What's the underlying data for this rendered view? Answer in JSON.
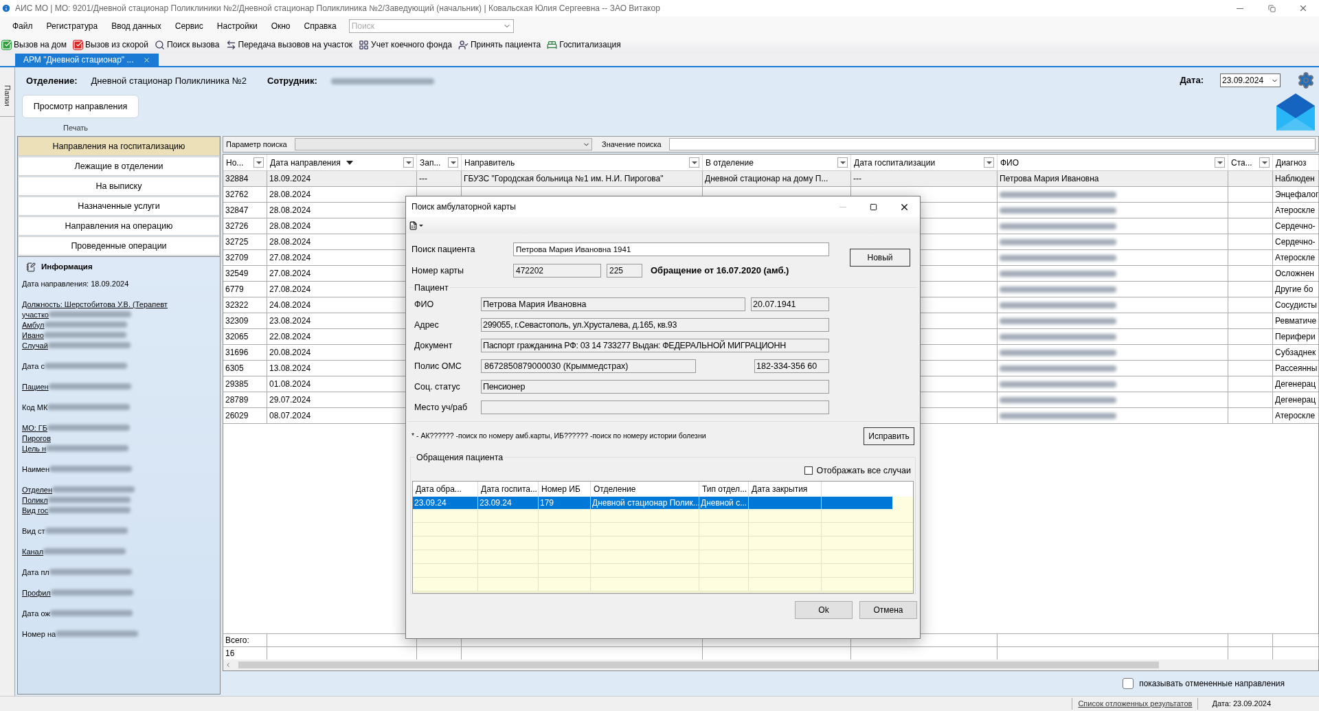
{
  "window": {
    "title": "АИС МО | МО: 9201/Дневной стационар Поликлиники №2/Дневной стационар Поликлиника №2/Заведующий (начальник) | Ковальская Юлия Сергеевна -- ЗАО Витакор"
  },
  "menu": [
    "Файл",
    "Регистратура",
    "Ввод данных",
    "Сервис",
    "Настройки",
    "Окно",
    "Справка"
  ],
  "search": {
    "placeholder": "Поиск"
  },
  "toolbar": [
    "Вызов на дом",
    "Вызов из скорой",
    "Поиск вызова",
    "Передача вызовов на участок",
    "Учет коечного фонда",
    "Принять пациента",
    "Госпитализация"
  ],
  "doc_tab": {
    "label": "АРМ \"Дневной стационар\" ..."
  },
  "side_strip": {
    "label": "Папки"
  },
  "header": {
    "department_label": "Отделение:",
    "department": "Дневной стационар Поликлиника №2",
    "employee_label": "Сотрудник:",
    "date_label": "Дата:",
    "date": "23.09.2024"
  },
  "actions": {
    "view_button": "Просмотр направления",
    "print": "Печать"
  },
  "nav": [
    {
      "label": "Направления на госпитализацию",
      "selected": true
    },
    {
      "label": "Лежащие в отделении",
      "selected": false
    },
    {
      "label": "На выписку",
      "selected": false
    },
    {
      "label": "Назначенные услуги",
      "selected": false
    },
    {
      "label": "Направления на операцию",
      "selected": false
    },
    {
      "label": "Проведенные операции",
      "selected": false
    }
  ],
  "info": {
    "title": "Информация",
    "groups": [
      [
        {
          "text": "Дата направления: 18.09.2024",
          "link": false,
          "blurred": false
        }
      ],
      [
        {
          "text": "Должность: Шерстобитова У.В. (Терапевт",
          "link": true,
          "blurred": false
        },
        {
          "text": "участко",
          "link": true,
          "blurred": true
        },
        {
          "text": "Амбул",
          "link": true,
          "blurred": true
        },
        {
          "text": "Ивано",
          "link": true,
          "blurred": true
        },
        {
          "text": "Случай",
          "link": true,
          "blurred": true
        }
      ],
      [
        {
          "text": "Дата с",
          "link": false,
          "blurred": true
        }
      ],
      [
        {
          "text": "Пациен",
          "link": true,
          "blurred": true
        }
      ],
      [
        {
          "text": "Код МК",
          "link": false,
          "blurred": true
        }
      ],
      [
        {
          "text": "МО: ГБ",
          "link": true,
          "blurred": true
        },
        {
          "text": "Пирогов",
          "link": true,
          "blurred": false
        },
        {
          "text": "Цель н",
          "link": true,
          "blurred": true
        }
      ],
      [
        {
          "text": "Наимен",
          "link": false,
          "blurred": true
        }
      ],
      [
        {
          "text": "Отделен",
          "link": true,
          "blurred": true
        },
        {
          "text": "Поликл",
          "link": true,
          "blurred": true
        },
        {
          "text": "Вид гос",
          "link": true,
          "blurred": true
        }
      ],
      [
        {
          "text": "Вид ст",
          "link": false,
          "blurred": true
        }
      ],
      [
        {
          "text": "Канал",
          "link": true,
          "blurred": true
        }
      ],
      [
        {
          "text": "Дата пл",
          "link": false,
          "blurred": true
        }
      ],
      [
        {
          "text": "Профил",
          "link": true,
          "blurred": true
        }
      ],
      [
        {
          "text": "Дата ож",
          "link": false,
          "blurred": true
        }
      ],
      [
        {
          "text": "Номер на",
          "link": false,
          "blurred": true
        }
      ]
    ]
  },
  "search_bar": {
    "param_label": "Параметр поиска",
    "value_label": "Значение поиска"
  },
  "grid": {
    "columns": [
      {
        "label": "Но...",
        "filter": true,
        "sorted": false
      },
      {
        "label": "Дата направления",
        "filter": true,
        "sorted": true
      },
      {
        "label": "Зап...",
        "filter": true,
        "sorted": false
      },
      {
        "label": "Направитель",
        "filter": true,
        "sorted": false
      },
      {
        "label": "В отделение",
        "filter": true,
        "sorted": false
      },
      {
        "label": "Дата госпитализации",
        "filter": true,
        "sorted": false
      },
      {
        "label": "ФИО",
        "filter": true,
        "sorted": false
      },
      {
        "label": "Ста...",
        "filter": true,
        "sorted": false
      },
      {
        "label": "Диагноз",
        "filter": false,
        "sorted": false
      }
    ],
    "rows": [
      {
        "selected": true,
        "cells": [
          "32884",
          "18.09.2024",
          "---",
          "ГБУЗС \"Городская больница №1 им. Н.И. Пирогова\"",
          "Дневной стационар на дому П...",
          "---",
          "Петрова Мария Ивановна",
          "",
          "Наблюден"
        ],
        "name_blurred": false
      },
      {
        "selected": false,
        "cells": [
          "32762",
          "28.08.2024",
          "",
          "",
          "",
          "",
          "",
          "",
          "Энцефалог"
        ],
        "name_blurred": true
      },
      {
        "selected": false,
        "cells": [
          "32847",
          "28.08.2024",
          "",
          "",
          "",
          "",
          "",
          "",
          "Атероскле"
        ],
        "name_blurred": true
      },
      {
        "selected": false,
        "cells": [
          "32726",
          "28.08.2024",
          "",
          "",
          "",
          "",
          "",
          "",
          "Сердечно-"
        ],
        "name_blurred": true
      },
      {
        "selected": false,
        "cells": [
          "32725",
          "28.08.2024",
          "",
          "",
          "",
          "",
          "",
          "",
          "Сердечно-"
        ],
        "name_blurred": true
      },
      {
        "selected": false,
        "cells": [
          "32709",
          "27.08.2024",
          "",
          "",
          "",
          "",
          "",
          "",
          "Атероскле"
        ],
        "name_blurred": true
      },
      {
        "selected": false,
        "cells": [
          "32549",
          "27.08.2024",
          "",
          "",
          "",
          "",
          "",
          "",
          "Осложнен"
        ],
        "name_blurred": true
      },
      {
        "selected": false,
        "cells": [
          "6779",
          "27.08.2024",
          "",
          "",
          "",
          "",
          "",
          "",
          "Другие бо"
        ],
        "name_blurred": true
      },
      {
        "selected": false,
        "cells": [
          "32322",
          "24.08.2024",
          "",
          "",
          "",
          "",
          "",
          "",
          "Сосудисты"
        ],
        "name_blurred": true
      },
      {
        "selected": false,
        "cells": [
          "32309",
          "23.08.2024",
          "",
          "",
          "",
          "",
          "",
          "",
          "Ревматиче"
        ],
        "name_blurred": true
      },
      {
        "selected": false,
        "cells": [
          "32065",
          "22.08.2024",
          "",
          "",
          "",
          "",
          "",
          "",
          "Перифери"
        ],
        "name_blurred": true
      },
      {
        "selected": false,
        "cells": [
          "31696",
          "20.08.2024",
          "",
          "",
          "",
          "",
          "",
          "",
          "Субзаднек"
        ],
        "name_blurred": true
      },
      {
        "selected": false,
        "cells": [
          "6305",
          "13.08.2024",
          "",
          "",
          "",
          "",
          "",
          "",
          "Рассеянны"
        ],
        "name_blurred": true
      },
      {
        "selected": false,
        "cells": [
          "29385",
          "01.08.2024",
          "",
          "",
          "",
          "",
          "",
          "",
          "Дегенерац"
        ],
        "name_blurred": true
      },
      {
        "selected": false,
        "cells": [
          "28789",
          "29.07.2024",
          "",
          "",
          "",
          "",
          "",
          "",
          "Дегенерац"
        ],
        "name_blurred": true
      },
      {
        "selected": false,
        "cells": [
          "26029",
          "08.07.2024",
          "",
          "",
          "",
          "",
          "",
          "",
          "Атероскле"
        ],
        "name_blurred": true
      }
    ],
    "total_label": "Всего:",
    "total": "16"
  },
  "show_cancelled": {
    "label": "показывать отмененные направления",
    "checked": false
  },
  "status_bar": {
    "link": "Список отложенных результатов",
    "date": "Дата: 23.09.2024"
  },
  "dialog": {
    "title": "Поиск амбулаторной карты",
    "search_label": "Поиск пациента",
    "search_value": "Петрова Мария Ивановна 1941",
    "new_button": "Новый",
    "card_label": "Номер карты",
    "card_number": "472202",
    "card_suffix": "225",
    "visit": "Обращение от 16.07.2020 (амб.)",
    "patient_group": "Пациент",
    "fields": [
      {
        "label": "ФИО",
        "value": "Петрова Мария Ивановна",
        "extra": "20.07.1941",
        "kind": "split"
      },
      {
        "label": "Адрес",
        "value": "299055, г.Севастополь, ул.Хрусталева, д.165, кв.93",
        "kind": "wide"
      },
      {
        "label": "Документ",
        "value": "Паспорт гражданина РФ: 03 14 733277 Выдан: ФЕДЕРАЛЬНОЙ МИГРАЦИОНН",
        "kind": "wide"
      },
      {
        "label": "Полис ОМС",
        "value": "8672850879000030 (Крыммедстрах)",
        "extra": "182-334-356 60",
        "kind": "gap"
      },
      {
        "label": "Соц. статус",
        "value": "Пенсионер",
        "kind": "wide"
      },
      {
        "label": "Место уч/раб",
        "kind": "wide"
      }
    ],
    "hint": "* - АК?????? -поиск по номеру амб.карты, ИБ?????? -поиск по номеру истории болезни",
    "fix_button": "Исправить",
    "visits_group": "Обращения пациента",
    "show_all": {
      "label": "Отображать все случаи",
      "checked": false
    },
    "visits": {
      "columns": [
        "Дата обра...",
        "Дата госпита...",
        "Номер ИБ",
        "Отделение",
        "Тип отдел...",
        "Дата закрытия"
      ],
      "rows": [
        {
          "selected": true,
          "cells": [
            "23.09.24",
            "23.09.24",
            "179",
            "Дневной стационар Полик...",
            "Дневной с...",
            ""
          ]
        }
      ]
    },
    "ok": "Ok",
    "cancel": "Отмена"
  }
}
